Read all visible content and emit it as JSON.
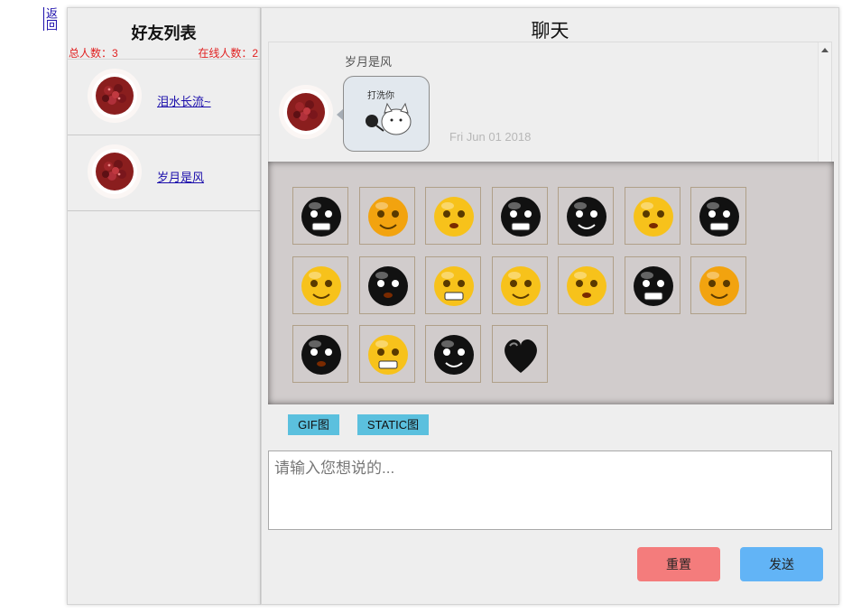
{
  "nav": {
    "back_label": "返回"
  },
  "friends": {
    "title": "好友列表",
    "total_label": "总人数：3",
    "online_label": "在线人数：2",
    "items": [
      {
        "name": "泪水长流~"
      },
      {
        "name": "岁月是风"
      }
    ]
  },
  "chat": {
    "title": "聊天",
    "message": {
      "sender": "岁月是风",
      "sticker_caption": "打洗你",
      "timestamp": "Fri Jun 01 2018"
    }
  },
  "emoji_tabs": {
    "gif": "GIF图",
    "static": "STATIC图"
  },
  "emoji_icons": [
    "black-blob-crying-icon",
    "orange-screaming-icon",
    "yellow-sleepy-icon",
    "black-worried-icon",
    "black-angry-teeth-icon",
    "yellow-sad-icon",
    "black-sinister-icon",
    "yellow-vomiting-icon",
    "black-grinning-icon",
    "yellow-shy-icon",
    "yellow-bandaged-icon",
    "yellow-bandaged-head-icon",
    "black-bomb-face-icon",
    "orange-dizzy-icon",
    "black-bruised-icon",
    "yellow-heart-eyes-icon",
    "black-laughing-icon",
    "black-heart-icon"
  ],
  "input": {
    "placeholder": "请输入您想说的..."
  },
  "actions": {
    "reset_label": "重置",
    "send_label": "发送"
  },
  "colors": {
    "reset_button": "#f47c7c",
    "send_button": "#62b4f6",
    "tab_button": "#5bc0de",
    "count_text": "#e02020"
  }
}
